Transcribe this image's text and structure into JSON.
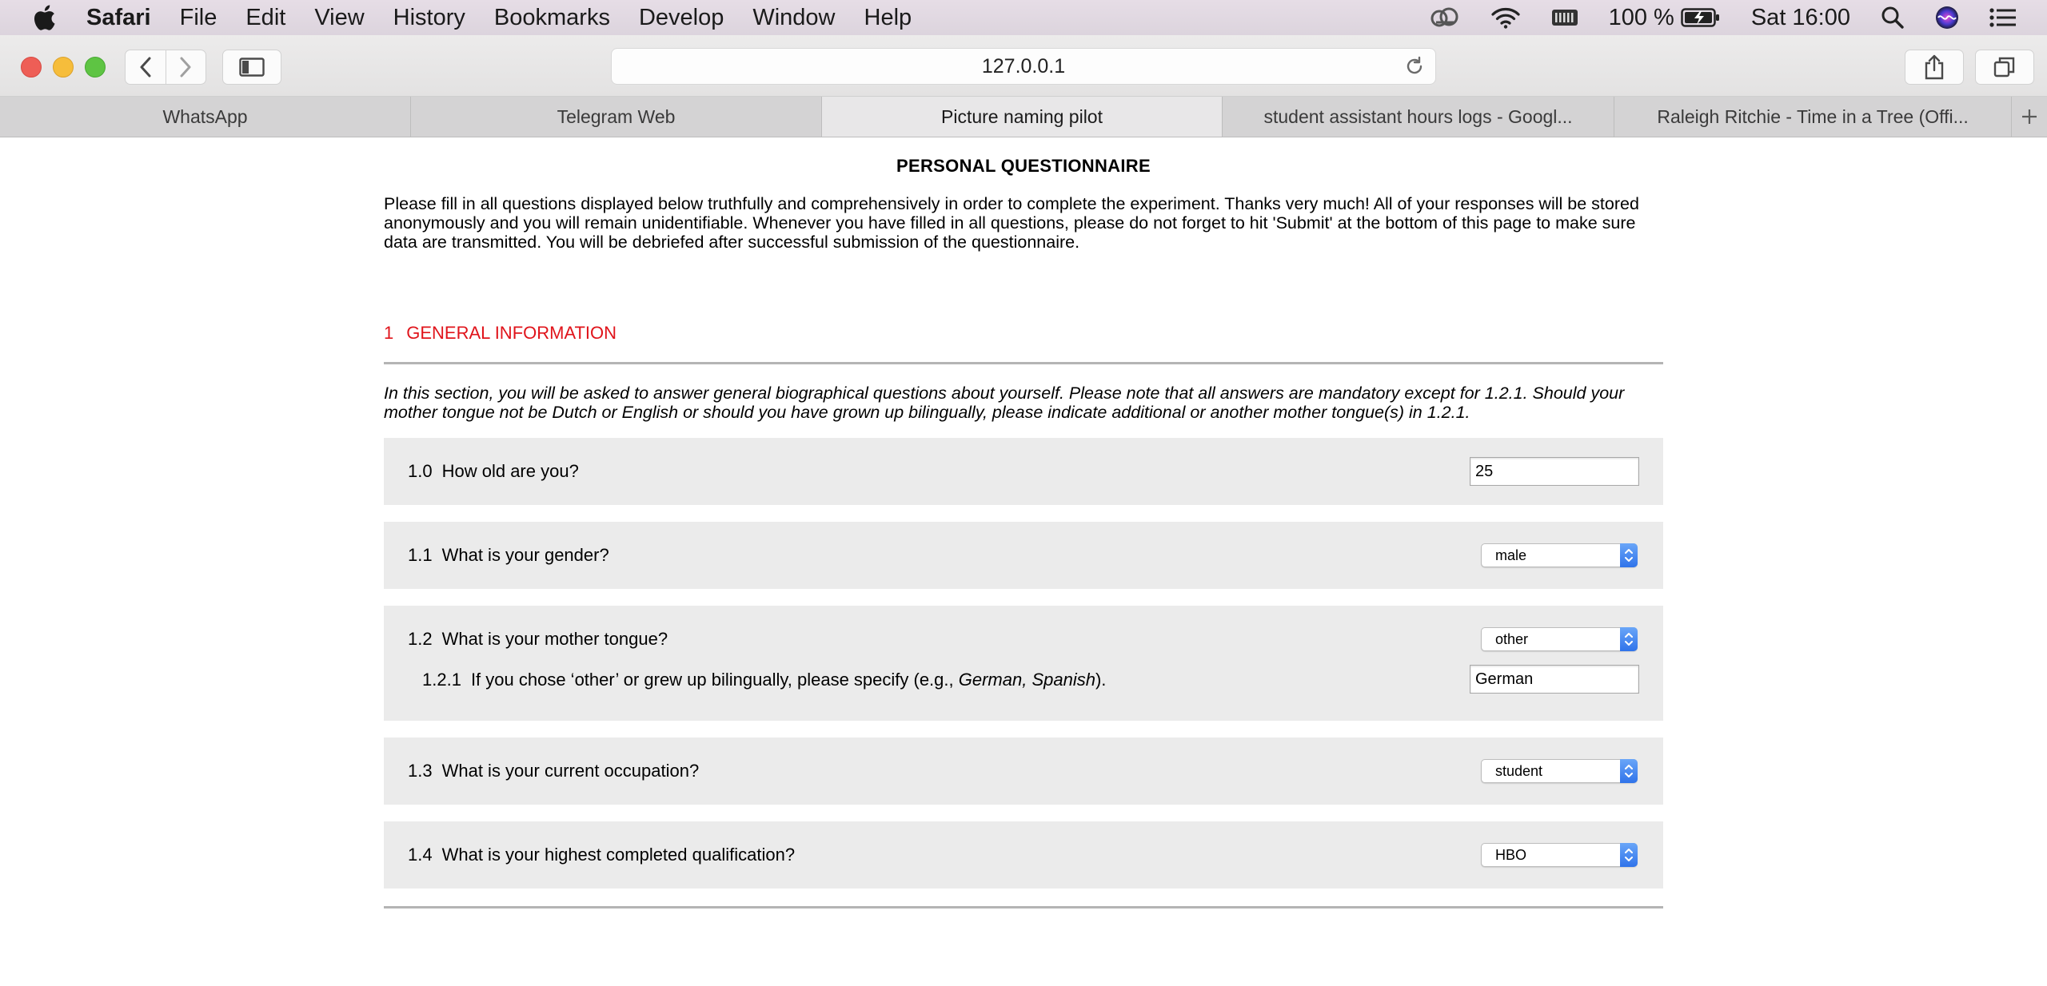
{
  "menubar": {
    "app_name": "Safari",
    "items": [
      "File",
      "Edit",
      "View",
      "History",
      "Bookmarks",
      "Develop",
      "Window",
      "Help"
    ],
    "battery_percent": "100 %",
    "clock": "Sat 16:00"
  },
  "toolbar": {
    "url": "127.0.0.1"
  },
  "tabs": [
    {
      "label": "WhatsApp"
    },
    {
      "label": "Telegram Web"
    },
    {
      "label": "Picture naming pilot"
    },
    {
      "label": "student assistant hours logs - Googl..."
    },
    {
      "label": "Raleigh Ritchie - Time in a Tree (Offi..."
    }
  ],
  "page": {
    "title": "PERSONAL QUESTIONNAIRE",
    "intro": "Please fill in all questions displayed below truthfully and comprehensively in order to complete the experiment. Thanks very much! All of your responses will be stored anonymously and you will remain unidentifiable. Whenever you have filled in all questions, please do not forget to hit 'Submit' at the bottom of this page to make sure data are transmitted. You will be debriefed after successful submission of the questionnaire.",
    "section": {
      "number": "1",
      "title": "GENERAL INFORMATION",
      "description": "In this section, you will be asked to answer general biographical questions about yourself. Please note that all answers are mandatory except for 1.2.1. Should your mother tongue not be Dutch or English or should you have grown up bilingually, please indicate additional or another mother tongue(s) in 1.2.1."
    },
    "questions": {
      "q10": {
        "number": "1.0",
        "label": "How old are you?",
        "value": "25"
      },
      "q11": {
        "number": "1.1",
        "label": "What is your gender?",
        "value": "male"
      },
      "q12": {
        "number": "1.2",
        "label": "What is your mother tongue?",
        "value": "other"
      },
      "q121": {
        "number": "1.2.1",
        "label_before": "If you chose ‘other’ or grew up bilingually, please specify (e.g., ",
        "label_examples": "German, Spanish",
        "label_after": ").",
        "value": "German"
      },
      "q13": {
        "number": "1.3",
        "label": "What is your current occupation?",
        "value": "student"
      },
      "q14": {
        "number": "1.4",
        "label": "What is your highest completed qualification?",
        "value": "HBO"
      }
    }
  }
}
